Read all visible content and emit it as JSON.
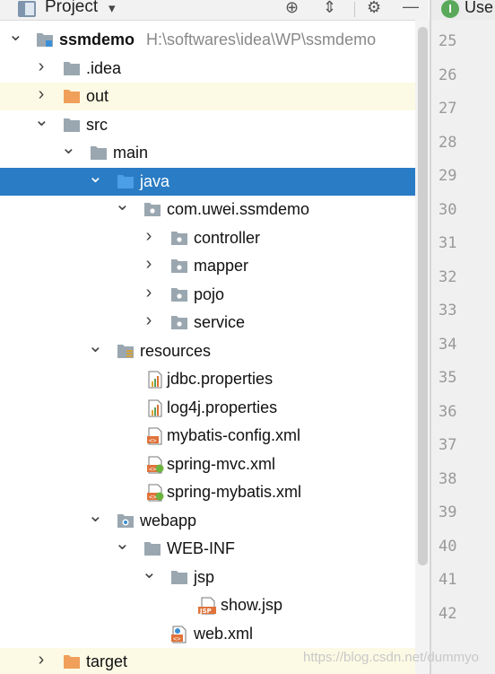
{
  "toolbar": {
    "title": "Project",
    "dropdown_icon": "chevron-down-icon",
    "buttons": [
      "locate-icon",
      "collapse-all-icon",
      "gear-icon",
      "minimize-icon"
    ]
  },
  "editor_tab": {
    "label": "Use",
    "icon": "interface-icon",
    "icon_letter": "I"
  },
  "tree": [
    {
      "label": "ssmdemo",
      "path": "H:\\softwares\\idea\\WP\\ssmdemo",
      "expanded": true,
      "icon": "module-icon"
    },
    {
      "label": ".idea",
      "expanded": false,
      "icon": "folder-icon"
    },
    {
      "label": "out",
      "expanded": false,
      "icon": "excluded-folder-icon",
      "highlighted": true
    },
    {
      "label": "src",
      "expanded": true,
      "icon": "folder-icon"
    },
    {
      "label": "main",
      "expanded": true,
      "icon": "folder-icon"
    },
    {
      "label": "java",
      "expanded": true,
      "icon": "source-folder-icon",
      "selected": true
    },
    {
      "label": "com.uwei.ssmdemo",
      "expanded": true,
      "icon": "package-icon"
    },
    {
      "label": "controller",
      "expanded": false,
      "icon": "package-icon"
    },
    {
      "label": "mapper",
      "expanded": false,
      "icon": "package-icon"
    },
    {
      "label": "pojo",
      "expanded": false,
      "icon": "package-icon"
    },
    {
      "label": "service",
      "expanded": false,
      "icon": "package-icon"
    },
    {
      "label": "resources",
      "expanded": true,
      "icon": "resources-folder-icon"
    },
    {
      "label": "jdbc.properties",
      "icon": "properties-file-icon"
    },
    {
      "label": "log4j.properties",
      "icon": "properties-file-icon"
    },
    {
      "label": "mybatis-config.xml",
      "icon": "xml-file-icon"
    },
    {
      "label": "spring-mvc.xml",
      "icon": "spring-xml-file-icon"
    },
    {
      "label": "spring-mybatis.xml",
      "icon": "spring-xml-file-icon"
    },
    {
      "label": "webapp",
      "expanded": true,
      "icon": "web-folder-icon"
    },
    {
      "label": "WEB-INF",
      "expanded": true,
      "icon": "folder-icon"
    },
    {
      "label": "jsp",
      "expanded": true,
      "icon": "folder-icon"
    },
    {
      "label": "show.jsp",
      "icon": "jsp-file-icon"
    },
    {
      "label": "web.xml",
      "icon": "web-xml-file-icon"
    },
    {
      "label": "target",
      "expanded": false,
      "icon": "excluded-folder-icon",
      "highlighted": true
    }
  ],
  "line_numbers": [
    "25",
    "26",
    "27",
    "28",
    "29",
    "30",
    "31",
    "32",
    "33",
    "34",
    "35",
    "36",
    "37",
    "38",
    "39",
    "40",
    "41",
    "42"
  ],
  "watermark": "https://blog.csdn.net/dummyo",
  "colors": {
    "selection": "#2a7cc5",
    "excluded_folder": "#f0a05a",
    "folder": "#9aa7b0",
    "source_folder": "#4a9fe6",
    "highlight_row": "#fcfae4"
  }
}
